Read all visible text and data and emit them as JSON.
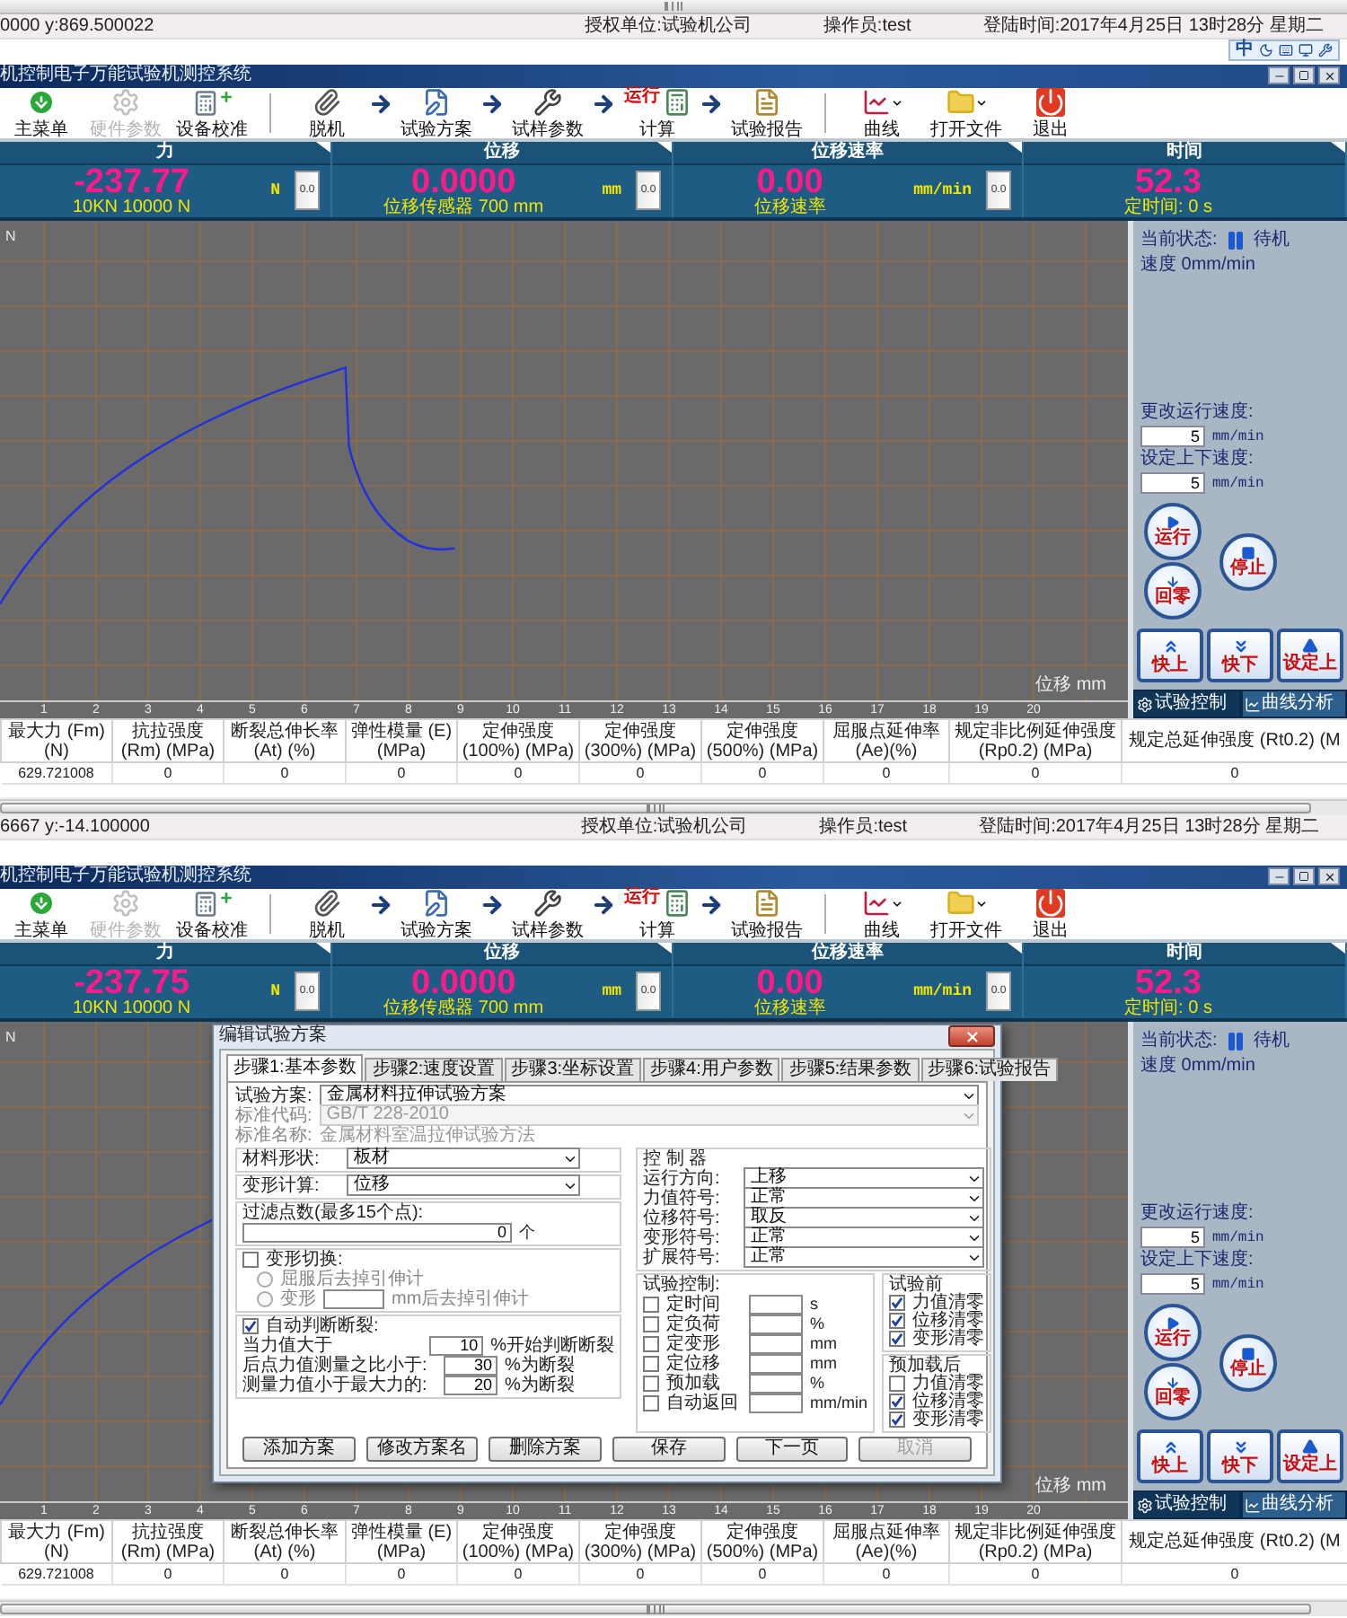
{
  "panels": [
    {
      "status_bar": {
        "coords": "0000 y:869.500022",
        "licensee": "授权单位:试验机公司",
        "operator": "操作员:test",
        "login_time": "登陆时间:2017年4月25日 13时28分 星期二"
      },
      "ime_bar": {
        "label": "中"
      },
      "window_title": "机控制电子万能试验机测控系统",
      "toolbar": [
        {
          "kind": "button",
          "label": "主菜单",
          "disabled": false,
          "dropdown": false
        },
        {
          "kind": "button",
          "label": "硬件参数",
          "disabled": true,
          "dropdown": false
        },
        {
          "kind": "button",
          "label": "设备校准",
          "disabled": false,
          "dropdown": false
        },
        {
          "kind": "separator"
        },
        {
          "kind": "button",
          "label": "脱机",
          "disabled": false,
          "dropdown": false
        },
        {
          "kind": "arrow"
        },
        {
          "kind": "button",
          "label": "试验方案",
          "disabled": false,
          "dropdown": false
        },
        {
          "kind": "arrow"
        },
        {
          "kind": "button",
          "label": "试样参数",
          "disabled": false,
          "dropdown": false
        },
        {
          "kind": "arrow"
        },
        {
          "kind": "button",
          "label": "计算",
          "badge": "运行",
          "disabled": false,
          "dropdown": false
        },
        {
          "kind": "arrow"
        },
        {
          "kind": "button",
          "label": "试验报告",
          "disabled": false,
          "dropdown": false
        },
        {
          "kind": "separator"
        },
        {
          "kind": "button",
          "label": "曲线",
          "disabled": false,
          "dropdown": true
        },
        {
          "kind": "button",
          "label": "打开文件",
          "disabled": false,
          "dropdown": true
        },
        {
          "kind": "button",
          "label": "退出",
          "disabled": false,
          "dropdown": false
        }
      ],
      "readouts": [
        {
          "label": "力",
          "value": "-237.77",
          "unit": "N",
          "zero_button": "0.0",
          "caption": "10KN 10000 N"
        },
        {
          "label": "位移",
          "value": "0.0000",
          "unit": "mm",
          "zero_button": "0.0",
          "caption": "位移传感器 700 mm"
        },
        {
          "label": "位移速率",
          "value": "0.00",
          "unit": "mm/min",
          "zero_button": "0.0",
          "caption": "位移速率"
        },
        {
          "label": "时间",
          "value": "52.3",
          "caption": "定时间: 0 s"
        }
      ],
      "chart": {
        "y_unit": "N",
        "x_label": "位移 mm",
        "x_ticks": [
          "1",
          "2",
          "3",
          "4",
          "5",
          "6",
          "7",
          "8",
          "9",
          "10",
          "11",
          "12",
          "13",
          "14",
          "15",
          "16",
          "17",
          "18",
          "19",
          "20"
        ]
      },
      "control_panel": {
        "status_label": "当前状态:",
        "status": "待机",
        "speed": "速度 0mm/min",
        "speed_fields": [
          {
            "label": "更改运行速度:",
            "value": "5",
            "unit": "mm/min"
          },
          {
            "label": "设定上下速度:",
            "value": "5",
            "unit": "mm/min"
          }
        ],
        "round_buttons": [
          "运行",
          "停止",
          "回零"
        ],
        "jog_buttons": [
          "快上",
          "快下",
          "设定上"
        ],
        "tabs": [
          {
            "label": "试验控制",
            "selected": true
          },
          {
            "label": "曲线分析",
            "selected": false
          }
        ]
      },
      "results_table": {
        "columns": [
          "最大力 (Fm) (N)",
          "抗拉强度 (Rm) (MPa)",
          "断裂总伸长率 (At) (%)",
          "弹性模量 (E) (MPa)",
          "定伸强度 (100%) (MPa)",
          "定伸强度 (300%) (MPa)",
          "定伸强度 (500%) (MPa)",
          "屈服点延伸率(Ae)(%)",
          "规定非比例延伸强度 (Rp0.2) (MPa)",
          "规定总延伸强度 (Rt0.2) (M"
        ],
        "rows": [
          [
            "629.721008",
            "0",
            "0",
            "0",
            "0",
            "0",
            "0",
            "0",
            "0",
            "0"
          ]
        ]
      }
    },
    {
      "status_bar": {
        "coords": "6667 y:-14.100000",
        "licensee": "授权单位:试验机公司",
        "operator": "操作员:test",
        "login_time": "登陆时间:2017年4月25日 13时28分 星期二"
      },
      "window_title": "机控制电子万能试验机测控系统",
      "toolbar": [
        {
          "kind": "button",
          "label": "主菜单",
          "disabled": false,
          "dropdown": false
        },
        {
          "kind": "button",
          "label": "硬件参数",
          "disabled": true,
          "dropdown": false
        },
        {
          "kind": "button",
          "label": "设备校准",
          "disabled": false,
          "dropdown": false
        },
        {
          "kind": "separator"
        },
        {
          "kind": "button",
          "label": "脱机",
          "disabled": false,
          "dropdown": false
        },
        {
          "kind": "arrow"
        },
        {
          "kind": "button",
          "label": "试验方案",
          "disabled": false,
          "dropdown": false
        },
        {
          "kind": "arrow"
        },
        {
          "kind": "button",
          "label": "试样参数",
          "disabled": false,
          "dropdown": false
        },
        {
          "kind": "arrow"
        },
        {
          "kind": "button",
          "label": "计算",
          "badge": "运行",
          "disabled": false,
          "dropdown": false
        },
        {
          "kind": "arrow"
        },
        {
          "kind": "button",
          "label": "试验报告",
          "disabled": false,
          "dropdown": false
        },
        {
          "kind": "separator"
        },
        {
          "kind": "button",
          "label": "曲线",
          "disabled": false,
          "dropdown": true
        },
        {
          "kind": "button",
          "label": "打开文件",
          "disabled": false,
          "dropdown": true
        },
        {
          "kind": "button",
          "label": "退出",
          "disabled": false,
          "dropdown": false
        }
      ],
      "readouts": [
        {
          "label": "力",
          "value": "-237.75",
          "unit": "N",
          "zero_button": "0.0",
          "caption": "10KN 10000 N"
        },
        {
          "label": "位移",
          "value": "0.0000",
          "unit": "mm",
          "zero_button": "0.0",
          "caption": "位移传感器 700 mm"
        },
        {
          "label": "位移速率",
          "value": "0.00",
          "unit": "mm/min",
          "zero_button": "0.0",
          "caption": "位移速率"
        },
        {
          "label": "时间",
          "value": "52.3",
          "caption": "定时间: 0 s"
        }
      ],
      "chart": {
        "y_unit": "N",
        "x_label": "位移 mm",
        "x_ticks": [
          "1",
          "2",
          "3",
          "4",
          "5",
          "6",
          "7",
          "8",
          "9",
          "10",
          "11",
          "12",
          "13",
          "14",
          "15",
          "16",
          "17",
          "18",
          "19",
          "20"
        ]
      },
      "control_panel": {
        "status_label": "当前状态:",
        "status": "待机",
        "speed": "速度 0mm/min",
        "speed_fields": [
          {
            "label": "更改运行速度:",
            "value": "5",
            "unit": "mm/min"
          },
          {
            "label": "设定上下速度:",
            "value": "5",
            "unit": "mm/min"
          }
        ],
        "round_buttons": [
          "运行",
          "停止",
          "回零"
        ],
        "jog_buttons": [
          "快上",
          "快下",
          "设定上"
        ],
        "tabs": [
          {
            "label": "试验控制",
            "selected": true
          },
          {
            "label": "曲线分析",
            "selected": false
          }
        ]
      },
      "results_table": {
        "columns": [
          "最大力 (Fm) (N)",
          "抗拉强度 (Rm) (MPa)",
          "断裂总伸长率 (At) (%)",
          "弹性模量 (E) (MPa)",
          "定伸强度 (100%) (MPa)",
          "定伸强度 (300%) (MPa)",
          "定伸强度 (500%) (MPa)",
          "屈服点延伸率(Ae)(%)",
          "规定非比例延伸强度 (Rp0.2) (MPa)",
          "规定总延伸强度 (Rt0.2) (M"
        ],
        "rows": [
          [
            "629.721008",
            "0",
            "0",
            "0",
            "0",
            "0",
            "0",
            "0",
            "0",
            "0"
          ]
        ]
      },
      "dialog": {
        "title": "编辑试验方案",
        "tabs": [
          {
            "label": "步骤1:基本参数",
            "selected": true
          },
          {
            "label": "步骤2:速度设置",
            "selected": false
          },
          {
            "label": "步骤3:坐标设置",
            "selected": false
          },
          {
            "label": "步骤4:用户参数",
            "selected": false
          },
          {
            "label": "步骤5:结果参数",
            "selected": false
          },
          {
            "label": "步骤6:试验报告",
            "selected": false
          }
        ],
        "plan_fields": [
          {
            "kind": "select",
            "label": "试验方案:",
            "value": "金属材料拉伸试验方案",
            "disabled": false
          },
          {
            "kind": "select",
            "label": "标准代码:",
            "value": "GB/T 228-2010",
            "disabled": true
          },
          {
            "kind": "text",
            "label": "标准名称:",
            "value": "金属材料室温拉伸试验方法",
            "disabled": true
          }
        ],
        "material_shape": {
          "legend": "材料形状:",
          "value": "板材"
        },
        "deformation_calc": {
          "legend": "变形计算:",
          "value": "位移"
        },
        "filter_points": {
          "legend": "过滤点数(最多15个点):",
          "value": "0",
          "unit": "个"
        },
        "controller": {
          "legend": "控 制 器",
          "rows": [
            {
              "label": "运行方向:",
              "value": "上移"
            },
            {
              "label": "力值符号:",
              "value": "正常"
            },
            {
              "label": "位移符号:",
              "value": "取反"
            },
            {
              "label": "变形符号:",
              "value": "正常"
            },
            {
              "label": "扩展符号:",
              "value": "正常"
            }
          ]
        },
        "extensometer_switch": {
          "label": "变形切换:",
          "checked": false,
          "options": [
            {
              "label": "屈服后去掉引伸计",
              "selected": false
            },
            {
              "label": "变形",
              "selected": false,
              "suffix": "mm后去掉引伸计"
            }
          ]
        },
        "auto_break": {
          "label": "自动判断断裂:",
          "checked": true,
          "rows": [
            {
              "label": "当力值大于",
              "value": "10",
              "unit": "%开始判断断裂"
            },
            {
              "label": "后点力值测量之比小于:",
              "value": "30",
              "unit": "%为断裂"
            },
            {
              "label": "测量力值小于最大力的:",
              "value": "20",
              "unit": "%为断裂"
            }
          ]
        },
        "test_control": {
          "legend": "试验控制:",
          "rows": [
            {
              "label": "定时间",
              "checked": false,
              "unit": "s"
            },
            {
              "label": "定负荷",
              "checked": false,
              "unit": "%"
            },
            {
              "label": "定变形",
              "checked": false,
              "unit": "mm"
            },
            {
              "label": "定位移",
              "checked": false,
              "unit": "mm"
            },
            {
              "label": "预加载",
              "checked": false,
              "unit": "%"
            },
            {
              "label": "自动返回",
              "checked": false,
              "unit": "mm/min"
            }
          ]
        },
        "before_test": {
          "legend": "试验前",
          "items": [
            {
              "label": "力值清零",
              "checked": true
            },
            {
              "label": "位移清零",
              "checked": true
            },
            {
              "label": "变形清零",
              "checked": true
            }
          ]
        },
        "after_preload": {
          "legend": "预加载后",
          "items": [
            {
              "label": "力值清零",
              "checked": false
            },
            {
              "label": "位移清零",
              "checked": true
            },
            {
              "label": "变形清零",
              "checked": true
            }
          ]
        },
        "buttons": [
          {
            "label": "添加方案",
            "disabled": false
          },
          {
            "label": "修改方案名",
            "disabled": false
          },
          {
            "label": "删除方案",
            "disabled": false
          },
          {
            "label": "保存",
            "disabled": false
          },
          {
            "label": "下一页",
            "disabled": false
          },
          {
            "label": "取消",
            "disabled": true
          }
        ]
      }
    }
  ]
}
